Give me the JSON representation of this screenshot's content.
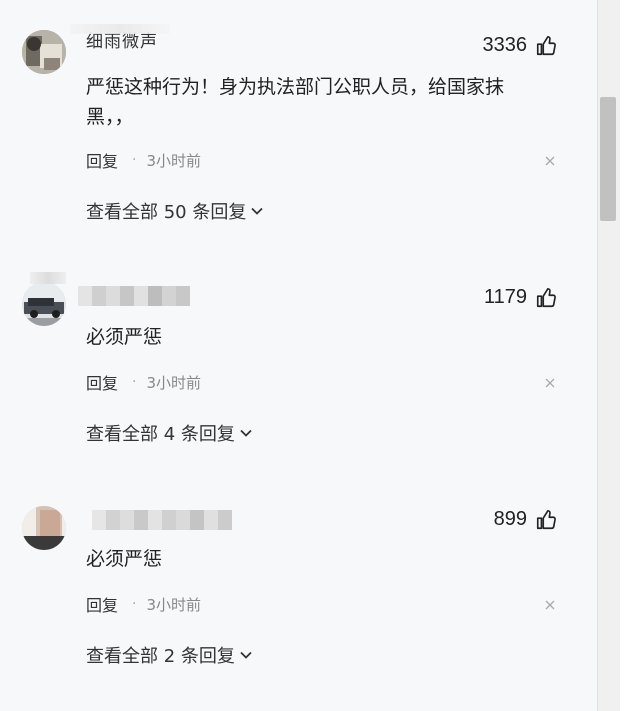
{
  "comments": [
    {
      "username": "细雨微声",
      "username_obscured": false,
      "likes": "3336",
      "text": "严惩这种行为！身为执法部门公职人员，给国家抹黑，，",
      "reply_label": "回复",
      "separator": "·",
      "time": "3小时前",
      "view_all": "查看全部 50 条回复"
    },
    {
      "username": "",
      "username_obscured": true,
      "likes": "1179",
      "text": "必须严惩",
      "reply_label": "回复",
      "separator": "·",
      "time": "3小时前",
      "view_all": "查看全部 4 条回复"
    },
    {
      "username": "",
      "username_obscured": true,
      "likes": "899",
      "text": "必须严惩",
      "reply_label": "回复",
      "separator": "·",
      "time": "3小时前",
      "view_all": "查看全部 2 条回复"
    }
  ],
  "icons": {
    "like": "thumbs-up-icon",
    "close": "close-icon",
    "expand": "chevron-down-icon"
  },
  "colors": {
    "background": "#f7f8fa",
    "text": "#222222",
    "secondary": "#888888",
    "scrollbar_thumb": "#c1c1c1"
  }
}
